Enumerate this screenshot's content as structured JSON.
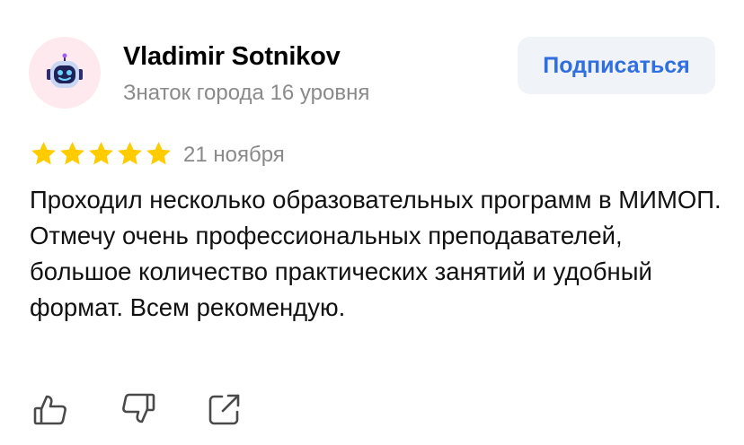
{
  "review": {
    "author": {
      "name": "Vladimir Sotnikov",
      "level": "Знаток города 16 уровня",
      "avatar_icon": "robot-avatar-icon"
    },
    "subscribe_label": "Подписаться",
    "rating": 5,
    "rating_max": 5,
    "date": "21 ноября",
    "text": "Проходил несколько образовательных программ в МИМОП. Отмечу очень профессиональных преподавателей, большое количество практических занятий и удобный формат. Всем рекомендую.",
    "actions": {
      "like_icon": "thumbs-up-icon",
      "dislike_icon": "thumbs-down-icon",
      "share_icon": "share-icon"
    }
  },
  "colors": {
    "star": "#ffcc00",
    "accent": "#2f6fe0",
    "button_bg": "#f0f3f8",
    "muted_text": "#8a8a8a",
    "avatar_bg": "#fde9ee"
  }
}
